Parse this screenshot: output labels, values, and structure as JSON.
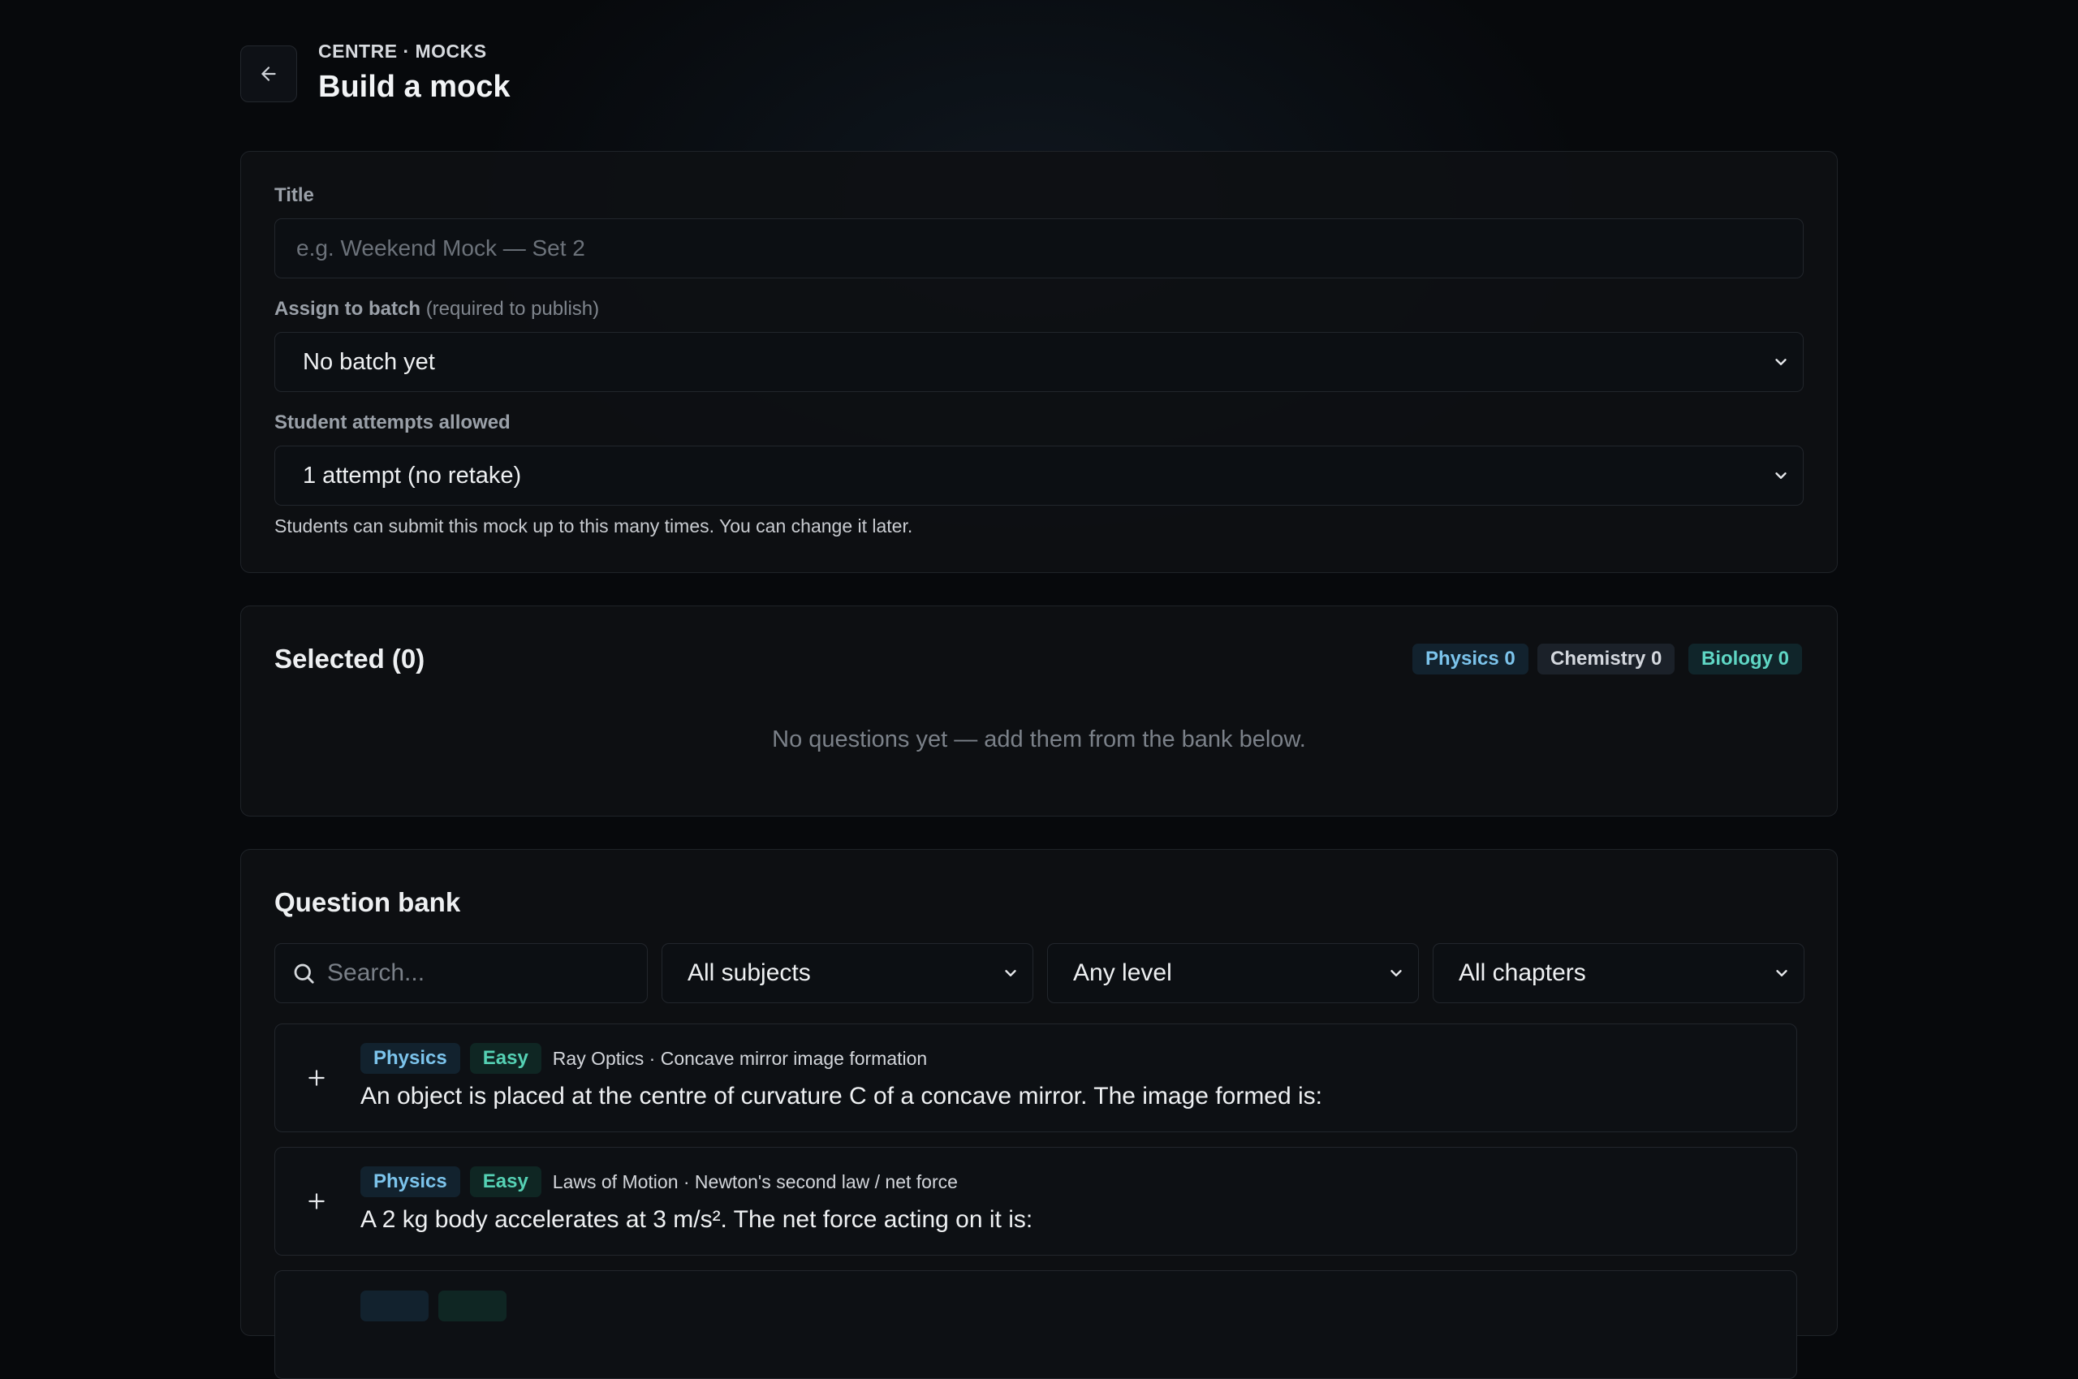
{
  "header": {
    "eyebrow": "CENTRE · MOCKS",
    "title": "Build a mock"
  },
  "form": {
    "title_label": "Title",
    "title_placeholder": "e.g. Weekend Mock — Set 2",
    "batch_label": "Assign to batch",
    "batch_note": "(required to publish)",
    "batch_value": "No batch yet",
    "attempts_label": "Student attempts allowed",
    "attempts_value": "1 attempt (no retake)",
    "attempts_hint": "Students can submit this mock up to this many times. You can change it later."
  },
  "selected": {
    "title": "Selected (0)",
    "counts": [
      {
        "label": "Physics 0"
      },
      {
        "label": "Chemistry 0"
      },
      {
        "label": "Biology 0"
      }
    ],
    "empty_text": "No questions yet — add them from the bank below."
  },
  "bank": {
    "title": "Question bank",
    "search_placeholder": "Search...",
    "subject_filter": "All subjects",
    "level_filter": "Any level",
    "chapter_filter": "All chapters",
    "questions": [
      {
        "subject": "Physics",
        "level": "Easy",
        "topic": "Ray Optics · Concave mirror image formation",
        "text": "An object is placed at the centre of curvature C of a concave mirror. The image formed is:"
      },
      {
        "subject": "Physics",
        "level": "Easy",
        "topic": "Laws of Motion · Newton's second law / net force",
        "text": "A 2 kg body accelerates at 3 m/s². The net force acting on it is:"
      }
    ]
  },
  "colors": {
    "background": "#07090c",
    "physics": "#7cc4ec",
    "biology": "#5fd6c4",
    "easy": "#55d1b4"
  },
  "icons": [
    "arrow-left-icon",
    "chevron-down-icon",
    "search-icon",
    "plus-icon"
  ]
}
